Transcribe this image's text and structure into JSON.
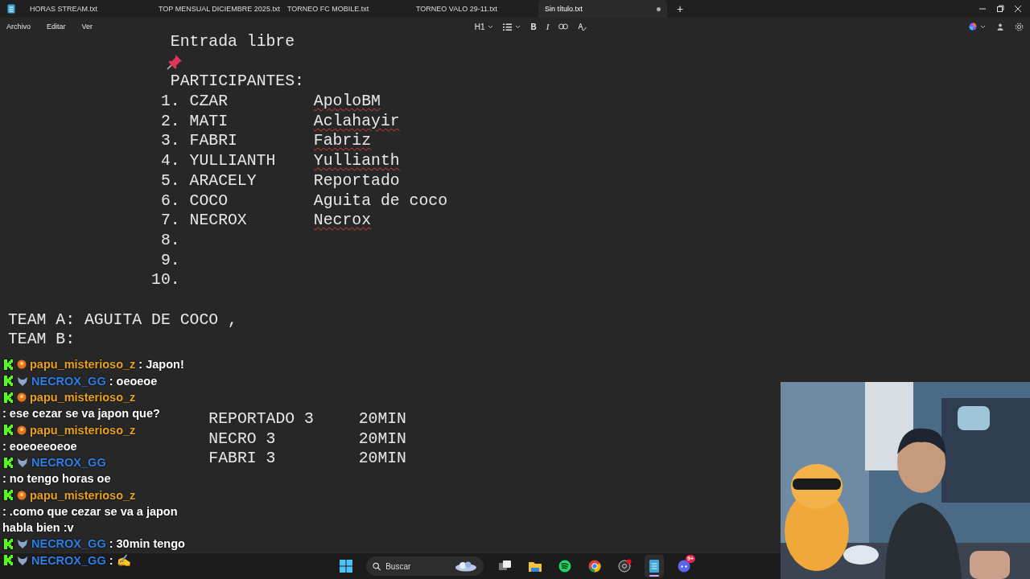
{
  "window": {
    "tabs": [
      {
        "label": "HORAS STREAM.txt",
        "selected": false,
        "modified": false
      },
      {
        "label": "TOP MENSUAL DICIEMBRE 2025.txt",
        "selected": false,
        "modified": false
      },
      {
        "label": "TORNEO FC MOBILE.txt",
        "selected": false,
        "modified": false
      },
      {
        "label": "TORNEO VALO 29-11.txt",
        "selected": false,
        "modified": false
      },
      {
        "label": "Sin título.txt",
        "selected": true,
        "modified": true
      }
    ],
    "new_tab": "+"
  },
  "menu": [
    "Archivo",
    "Editar",
    "Ver"
  ],
  "toolbar": [
    {
      "kind": "heading",
      "label": "H1"
    },
    {
      "kind": "list"
    },
    {
      "kind": "bold",
      "label": "B"
    },
    {
      "kind": "italic",
      "label": "I"
    },
    {
      "kind": "link"
    },
    {
      "kind": "spellcheck"
    }
  ],
  "document": {
    "lines": [
      {
        "kind": "title",
        "text": "Entrada libre"
      },
      {
        "kind": "pin"
      },
      {
        "kind": "title",
        "text": "PARTICIPANTES:"
      },
      {
        "kind": "entry",
        "number": "1.",
        "player": "CZAR",
        "name": "ApoloBM",
        "misspelled": true
      },
      {
        "kind": "entry",
        "number": "2.",
        "player": "MATI",
        "name": "Aclahayir",
        "misspelled": true
      },
      {
        "kind": "entry",
        "number": "3.",
        "player": "FABRI",
        "name": "Fabriz",
        "misspelled": true
      },
      {
        "kind": "entry",
        "number": "4.",
        "player": "YULLIANTH",
        "name": "Yullianth",
        "misspelled": true
      },
      {
        "kind": "entry",
        "number": "5.",
        "player": "ARACELY",
        "name": "Reportado",
        "misspelled": false
      },
      {
        "kind": "entry",
        "number": "6.",
        "player": "COCO",
        "name": "Aguita de coco",
        "misspelled": false
      },
      {
        "kind": "entry",
        "number": "7.",
        "player": "NECROX",
        "name": "Necrox",
        "misspelled": true
      },
      {
        "kind": "entry",
        "number": "8."
      },
      {
        "kind": "entry",
        "number": "9."
      },
      {
        "kind": "entry",
        "number": "10."
      },
      {
        "kind": "blank"
      },
      {
        "kind": "team",
        "text": "TEAM A: AGUITA DE COCO ,"
      },
      {
        "kind": "team",
        "text": "TEAM B:"
      },
      {
        "kind": "blank"
      },
      {
        "kind": "blank"
      },
      {
        "kind": "blank"
      },
      {
        "kind": "result",
        "text": "REPORTADO 3",
        "time": "20MIN"
      },
      {
        "kind": "result",
        "text": "NECRO 3",
        "time": "20MIN"
      },
      {
        "kind": "result",
        "text": "FABRI 3",
        "time": "20MIN"
      }
    ]
  },
  "chat": [
    {
      "user": "papu_misterioso_z",
      "color": "#e9a21c",
      "kind": "ball",
      "text": ": Japon!"
    },
    {
      "user": "NECROX_GG",
      "color": "#2f7fe6",
      "kind": "creature",
      "text": ": oeoeoe"
    },
    {
      "user": "papu_misterioso_z",
      "color": "#e9a21c",
      "kind": "ball",
      "text": ": ese cezar se va japon que?"
    },
    {
      "user": "papu_misterioso_z",
      "color": "#e9a21c",
      "kind": "ball",
      "text": ": eoeoeeoeoe"
    },
    {
      "user": "NECROX_GG",
      "color": "#2f7fe6",
      "kind": "creature",
      "text": ": no tengo horas oe"
    },
    {
      "user": "papu_misterioso_z",
      "color": "#e9a21c",
      "kind": "ball",
      "text": ": .como que cezar se va a japon habla bien :v"
    },
    {
      "user": "NECROX_GG",
      "color": "#2f7fe6",
      "kind": "creature",
      "text": ": 30min tengo"
    },
    {
      "user": "NECROX_GG",
      "color": "#2f7fe6",
      "kind": "creature",
      "text": ": ✍"
    }
  ],
  "taskbar": {
    "search": {
      "placeholder": "Buscar"
    },
    "apps": [
      {
        "kind": "start",
        "selected": false
      },
      {
        "kind": "search"
      },
      {
        "kind": "taskview",
        "selected": false
      },
      {
        "kind": "folder",
        "selected": false
      },
      {
        "kind": "music",
        "selected": false
      },
      {
        "kind": "browser",
        "selected": false
      },
      {
        "kind": "recorder",
        "selected": false
      },
      {
        "kind": "notepad",
        "selected": true
      },
      {
        "kind": "chat",
        "selected": false,
        "badge": "9+"
      }
    ]
  }
}
